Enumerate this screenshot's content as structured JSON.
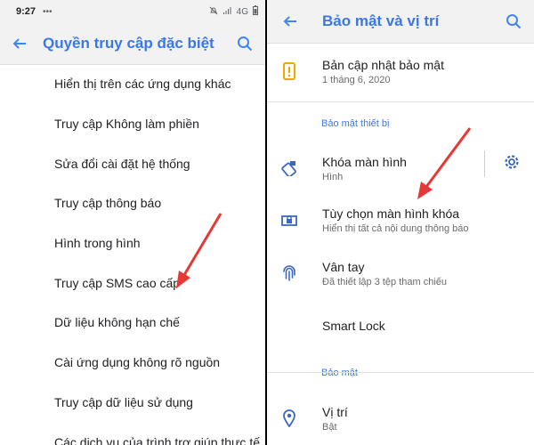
{
  "left": {
    "status": {
      "time": "9:27",
      "dots": "•••",
      "network": "4G"
    },
    "appbar": {
      "title": "Quyền truy cập đặc biệt"
    },
    "items": [
      {
        "label": "Hiển thị trên các ứng dụng khác"
      },
      {
        "label": "Truy cập Không làm phiền"
      },
      {
        "label": "Sửa đổi cài đặt hệ thống"
      },
      {
        "label": "Truy cập thông báo"
      },
      {
        "label": "Hình trong hình"
      },
      {
        "label": "Truy cập SMS cao cấp"
      },
      {
        "label": "Dữ liệu không hạn chế"
      },
      {
        "label": "Cài ứng dụng không rõ nguồn"
      },
      {
        "label": "Truy cập dữ liệu sử dụng"
      },
      {
        "label": "Các dịch vụ của trình trợ giúp thực tế"
      }
    ]
  },
  "right": {
    "appbar": {
      "title": "Bảo mật và vị trí"
    },
    "update": {
      "title": "Bản cập nhật bảo mật",
      "subtitle": "1 tháng 6, 2020"
    },
    "section_device": "Bảo mật thiết bị",
    "screen_lock": {
      "title": "Khóa màn hình",
      "subtitle": "Hình"
    },
    "lock_options": {
      "title": "Tùy chọn màn hình khóa",
      "subtitle": "Hiển thị tất cả nội dung thông báo"
    },
    "fingerprint": {
      "title": "Vân tay",
      "subtitle": "Đã thiết lập 3 tệp tham chiếu"
    },
    "smart_lock": {
      "title": "Smart Lock"
    },
    "section_security": "Bảo mật",
    "location": {
      "title": "Vị trí",
      "subtitle": "Bật"
    }
  },
  "colors": {
    "accent": "#3b78e7",
    "arrow": "#e53935",
    "warning": "#f2a600"
  }
}
